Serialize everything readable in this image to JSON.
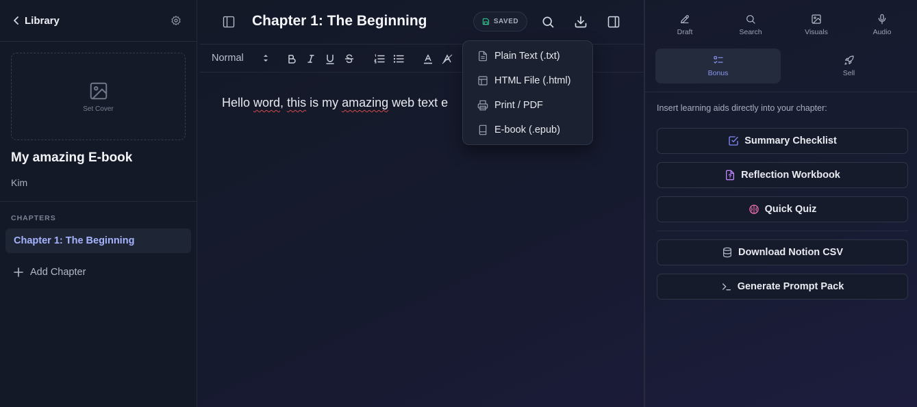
{
  "sidebar": {
    "back_label": "Library",
    "cover_label": "Set Cover",
    "book_title": "My amazing E-book",
    "author": "Kim",
    "chapters_heading": "CHAPTERS",
    "chapters": [
      {
        "label": "Chapter 1: The Beginning",
        "active": true
      }
    ],
    "add_chapter_label": "Add Chapter"
  },
  "editor": {
    "chapter_title": "Chapter 1: The Beginning",
    "save_status": "SAVED",
    "text_style": "Normal",
    "content_parts": [
      "Hello ",
      "word",
      ", ",
      "this",
      " is my ",
      "amazing",
      " web text e"
    ]
  },
  "export_menu": {
    "items": [
      {
        "label": "Plain Text (.txt)",
        "icon": "file-text-icon"
      },
      {
        "label": "HTML File (.html)",
        "icon": "layout-icon"
      },
      {
        "label": "Print / PDF",
        "icon": "printer-icon"
      },
      {
        "label": "E-book (.epub)",
        "icon": "book-icon"
      }
    ]
  },
  "panel": {
    "tabs": [
      {
        "label": "Draft",
        "icon": "pencil-icon"
      },
      {
        "label": "Search",
        "icon": "search-icon"
      },
      {
        "label": "Visuals",
        "icon": "image-icon"
      },
      {
        "label": "Audio",
        "icon": "mic-icon"
      }
    ],
    "subtabs": [
      {
        "label": "Bonus",
        "icon": "list-check-icon",
        "active": true
      },
      {
        "label": "Sell",
        "icon": "rocket-icon",
        "active": false
      }
    ],
    "instruction": "Insert learning aids directly into your chapter:",
    "actions": [
      {
        "label": "Summary Checklist",
        "icon": "check-square-icon"
      },
      {
        "label": "Reflection Workbook",
        "icon": "file-icon"
      },
      {
        "label": "Quick Quiz",
        "icon": "brain-icon"
      },
      {
        "label": "Download Notion CSV",
        "icon": "database-icon"
      },
      {
        "label": "Generate Prompt Pack",
        "icon": "terminal-icon"
      }
    ]
  },
  "colors": {
    "accent": "#8b95f0",
    "checklist_icon": "#818cf8",
    "workbook_icon": "#c084fc",
    "quiz_icon": "#f472b6",
    "saved_icon": "#34d399",
    "spellcheck": "#d14b4b"
  }
}
